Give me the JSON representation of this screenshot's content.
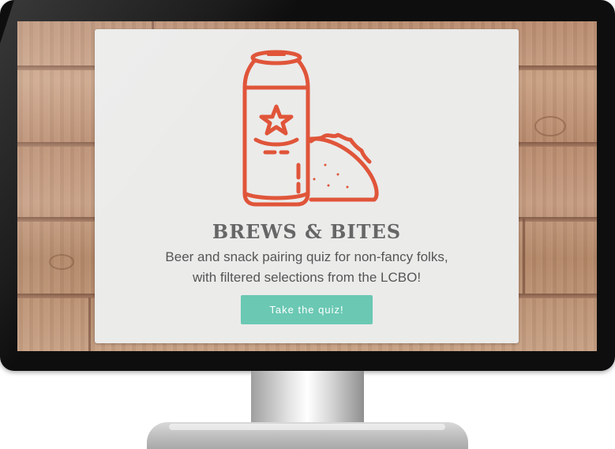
{
  "hero": {
    "title": "BREWS & BITES",
    "subtitle_line1": "Beer and snack pairing quiz for non-fancy folks,",
    "subtitle_line2": "with filtered selections from the LCBO!",
    "cta_label": "Take the quiz!"
  },
  "icons": {
    "illustration": "beer-can-and-taco-icon"
  },
  "colors": {
    "accent": "#6ac8b3",
    "illustration_stroke": "#e0553a",
    "card_background": "#ebebea",
    "title_text": "#666666",
    "body_text": "#555555"
  }
}
